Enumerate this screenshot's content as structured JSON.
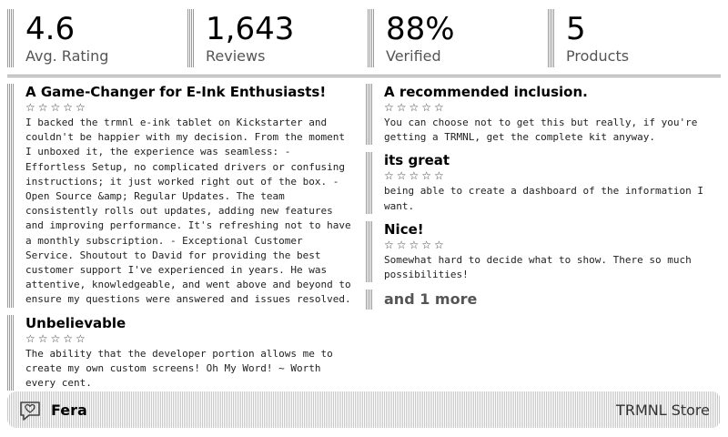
{
  "stats": [
    {
      "value": "4.6",
      "label": "Avg. Rating"
    },
    {
      "value": "1,643",
      "label": "Reviews"
    },
    {
      "value": "88%",
      "label": "Verified"
    },
    {
      "value": "5",
      "label": "Products"
    }
  ],
  "reviews_left": [
    {
      "title": "A Game-Changer for E-Ink Enthusiasts!",
      "stars": "☆☆☆☆☆",
      "body": "I backed the trmnl e-ink tablet on Kickstarter and couldn't be happier with my decision. From the moment I unboxed it, the experience was seamless: - Effortless Setup, no complicated drivers or confusing instructions; it just worked right out of the box. - Open Source &amp; Regular Updates. The team consistently rolls out updates, adding new features and improving performance. It's refreshing not to have a monthly subscription. - Exceptional Customer Service. Shoutout to David for providing the best customer support I've experienced in years. He was attentive, knowledgeable, and went above and beyond to ensure my questions were answered and issues resolved."
    },
    {
      "title": "Unbelievable",
      "stars": "☆☆☆☆☆",
      "body": "The ability that the developer portion allows me to create my own custom screens! Oh My Word! ~ Worth every cent."
    }
  ],
  "reviews_right": [
    {
      "title": "A recommended inclusion.",
      "stars": "☆☆☆☆☆",
      "body": "You can choose not to get this but really, if you're getting a TRMNL, get the complete kit anyway."
    },
    {
      "title": "its great",
      "stars": "☆☆☆☆☆",
      "body": "being able to create a dashboard of the information I want."
    },
    {
      "title": "Nice!",
      "stars": "☆☆☆☆☆",
      "body": "Somewhat hard to decide what to show. There so much possibilities!"
    }
  ],
  "more_text": "and 1 more",
  "footer": {
    "icon": "heart-chat-icon",
    "name": "Fera",
    "store": "TRMNL Store"
  }
}
